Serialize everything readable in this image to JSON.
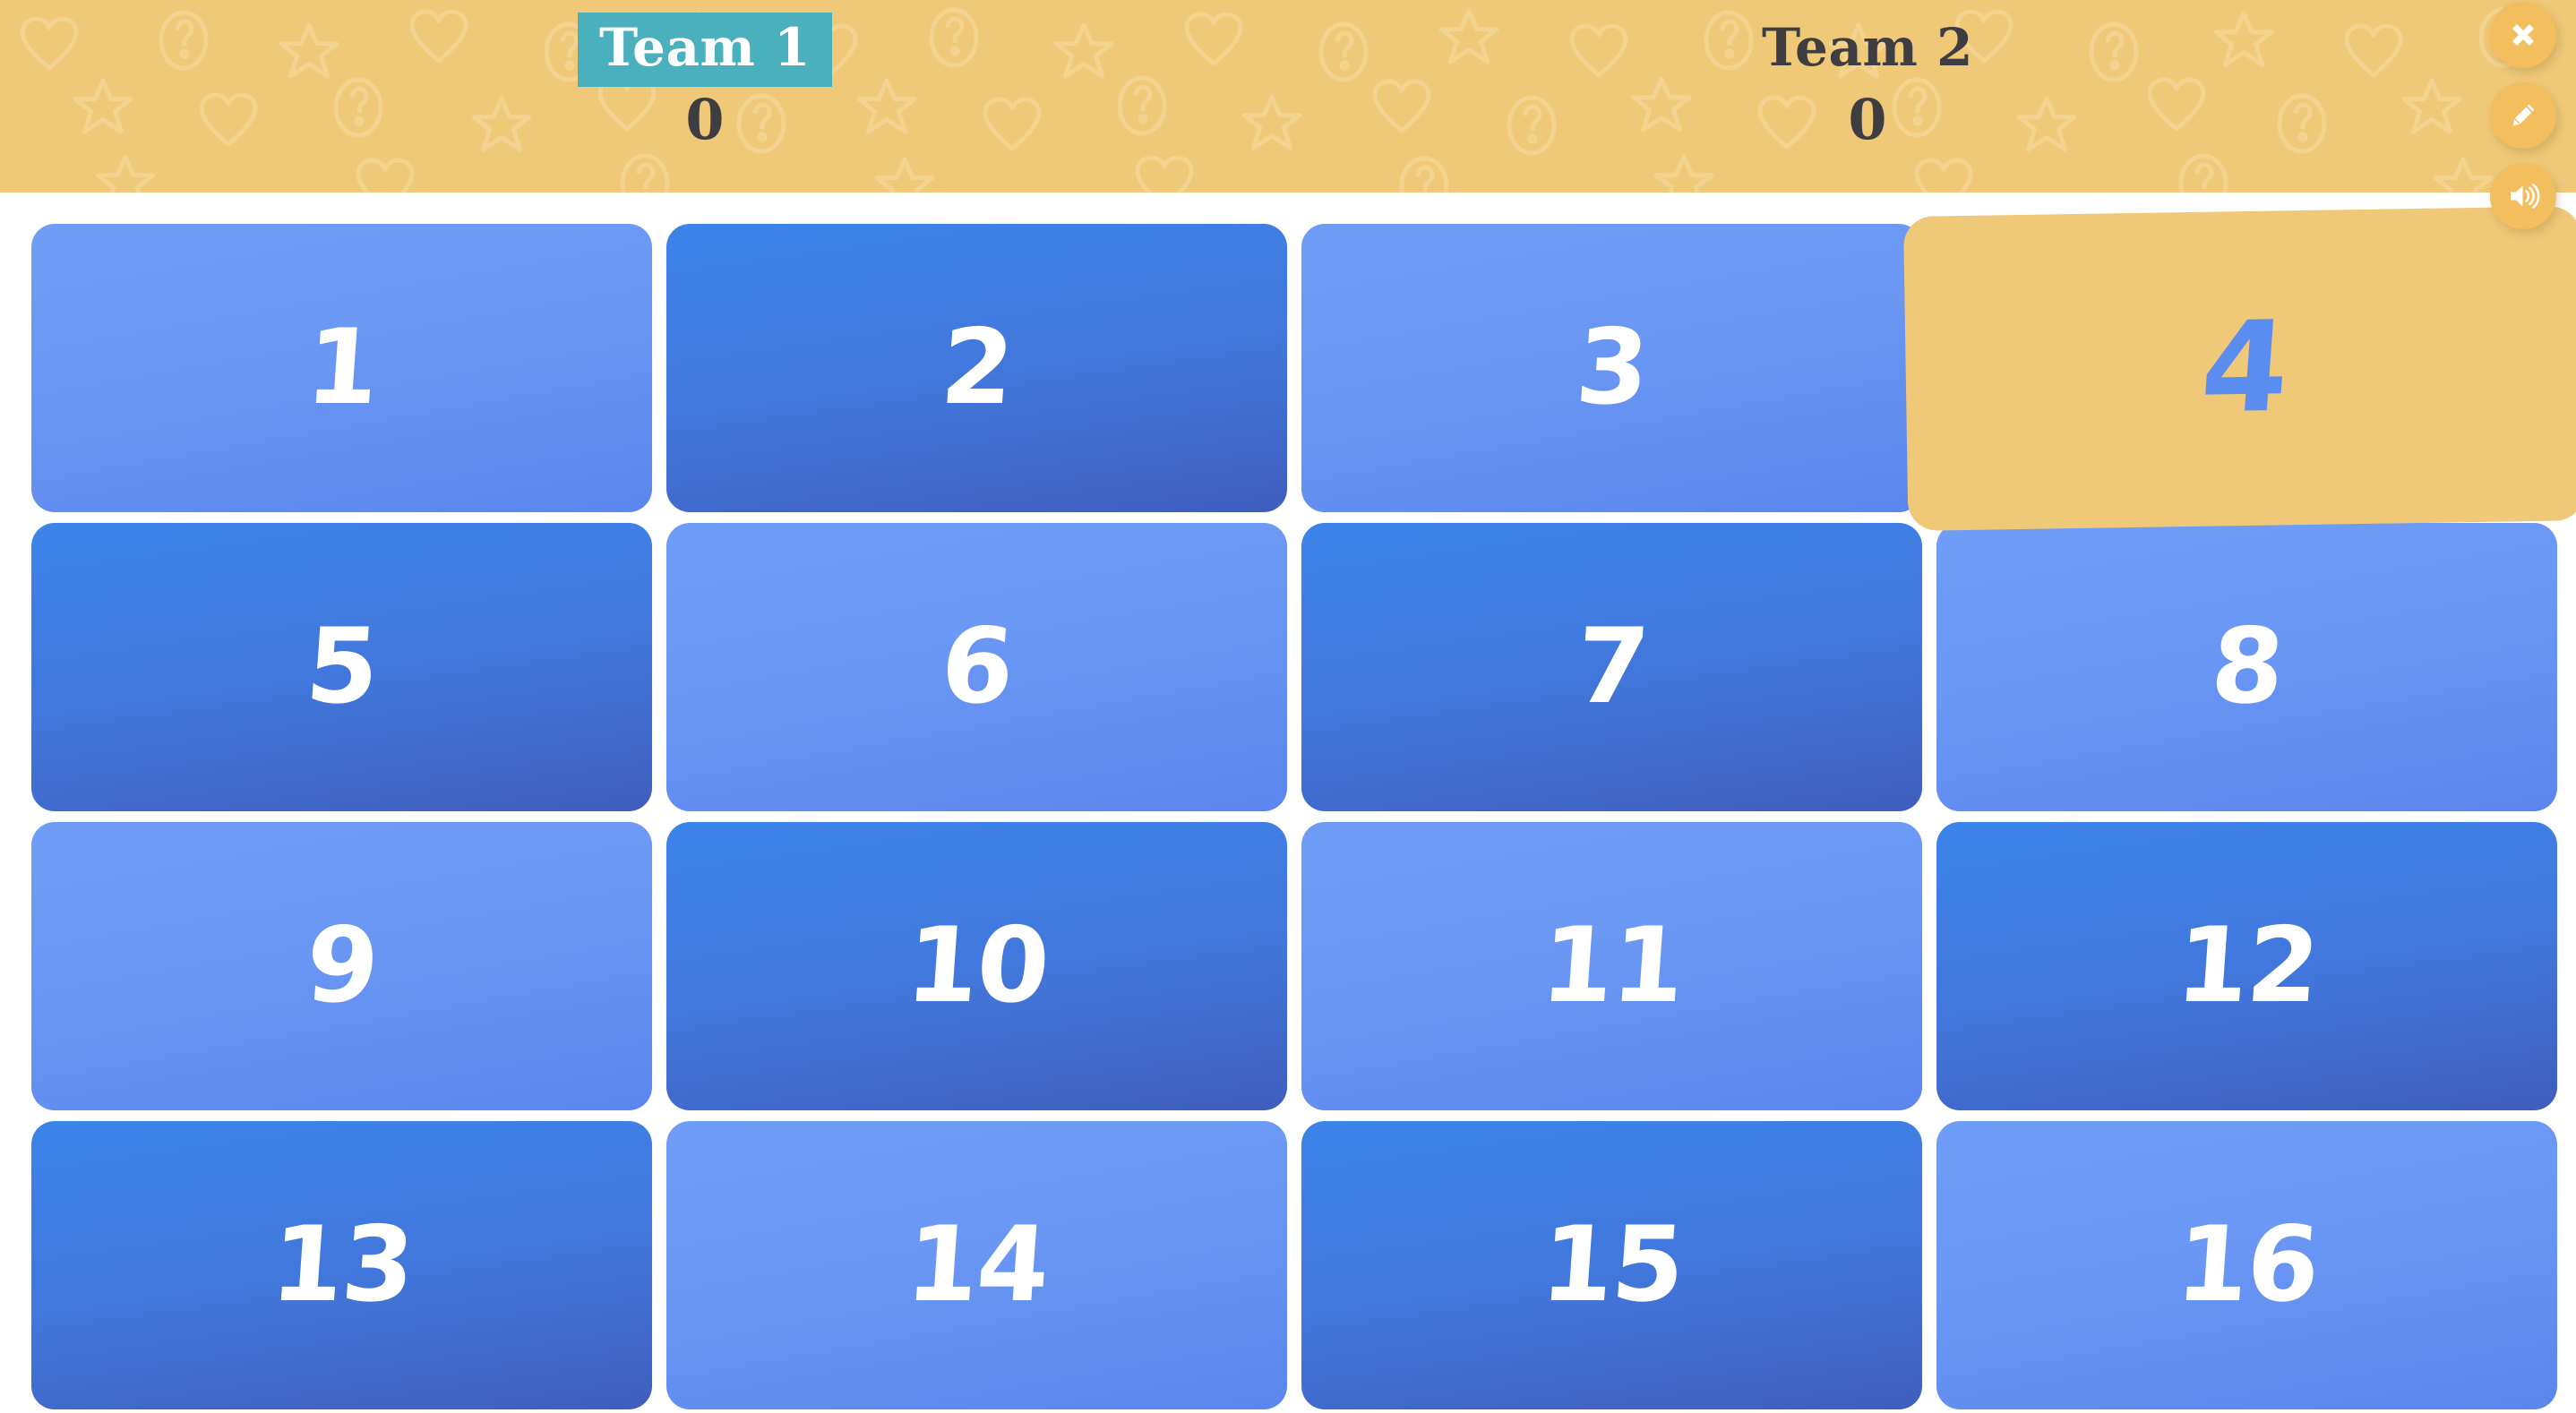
{
  "header": {
    "background_color": "#EFC878",
    "pattern_icons": [
      "star-icon",
      "heart-icon",
      "question-mark-icon"
    ],
    "teams": [
      {
        "name": "Team 1",
        "score": "0",
        "active": true,
        "highlight_color": "#4BB0BE",
        "name_color": "#FFFFFF",
        "score_color": "#3E3E42"
      },
      {
        "name": "Team 2",
        "score": "0",
        "active": false,
        "highlight_color": "transparent",
        "name_color": "#3E3E42",
        "score_color": "#3E3E42"
      }
    ]
  },
  "controls": [
    {
      "name": "close-button",
      "icon": "close-icon",
      "label": "Close"
    },
    {
      "name": "edit-button",
      "icon": "pencil-icon",
      "label": "Edit"
    },
    {
      "name": "sound-button",
      "icon": "speaker-icon",
      "label": "Sound"
    }
  ],
  "control_button_color": "#F2BE5E",
  "grid": {
    "columns": 4,
    "rows": 4,
    "tiles": [
      {
        "label": "1",
        "shade": "light",
        "state": "hidden"
      },
      {
        "label": "2",
        "shade": "dark",
        "state": "hidden"
      },
      {
        "label": "3",
        "shade": "light",
        "state": "hidden"
      },
      {
        "label": "4",
        "shade": "dark",
        "state": "revealed"
      },
      {
        "label": "5",
        "shade": "dark",
        "state": "hidden"
      },
      {
        "label": "6",
        "shade": "light",
        "state": "hidden"
      },
      {
        "label": "7",
        "shade": "dark",
        "state": "hidden"
      },
      {
        "label": "8",
        "shade": "light",
        "state": "hidden"
      },
      {
        "label": "9",
        "shade": "light",
        "state": "hidden"
      },
      {
        "label": "10",
        "shade": "dark",
        "state": "hidden"
      },
      {
        "label": "11",
        "shade": "light",
        "state": "hidden"
      },
      {
        "label": "12",
        "shade": "dark",
        "state": "hidden"
      },
      {
        "label": "13",
        "shade": "dark",
        "state": "hidden"
      },
      {
        "label": "14",
        "shade": "light",
        "state": "hidden"
      },
      {
        "label": "15",
        "shade": "dark",
        "state": "hidden"
      },
      {
        "label": "16",
        "shade": "light",
        "state": "hidden"
      }
    ],
    "tile_text_color": "#FFFFFF",
    "revealed_background": "#EFC878",
    "revealed_text_color": "#5B8DF0"
  }
}
